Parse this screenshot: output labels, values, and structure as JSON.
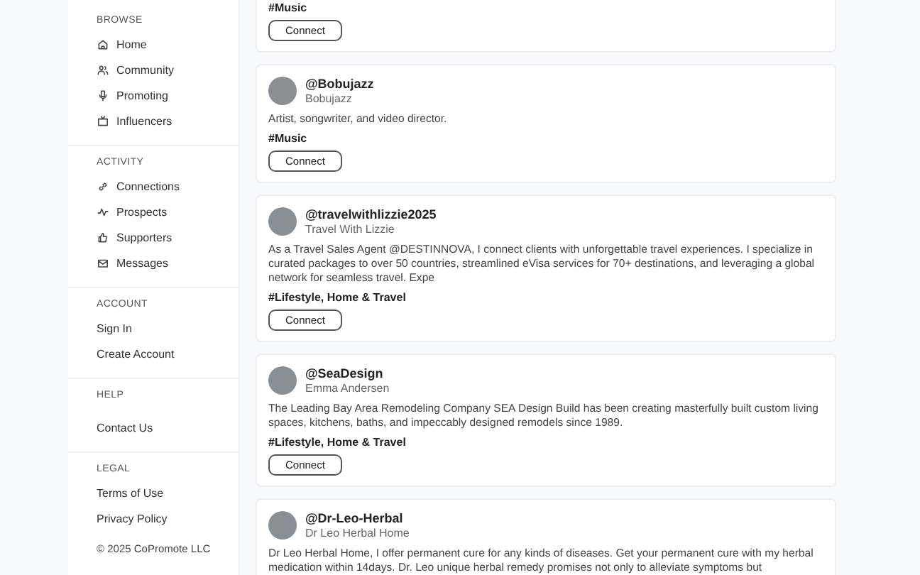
{
  "sidebar": {
    "sections": [
      {
        "heading": "BROWSE",
        "items": [
          "Home",
          "Community",
          "Promoting",
          "Influencers"
        ]
      },
      {
        "heading": "ACTIVITY",
        "items": [
          "Connections",
          "Prospects",
          "Supporters",
          "Messages"
        ]
      },
      {
        "heading": "ACCOUNT",
        "items": [
          "Sign In",
          "Create Account"
        ]
      },
      {
        "heading": "HELP",
        "items": [
          "Contact Us"
        ]
      },
      {
        "heading": "LEGAL",
        "items": [
          "Terms of Use",
          "Privacy Policy"
        ]
      }
    ],
    "copyright": "© 2025 CoPromote LLC"
  },
  "cards": [
    {
      "tag": "#Music",
      "button": "Connect"
    },
    {
      "handle": "@Bobujazz",
      "name": "Bobujazz",
      "bio": "Artist, songwriter, and video director.",
      "tag": "#Music",
      "button": "Connect"
    },
    {
      "handle": "@travelwithlizzie2025",
      "name": "Travel With Lizzie",
      "bio": "As a Travel Sales Agent @DESTINNOVA, I connect clients with unforgettable travel experiences. I specialize in curated packages to over 50 countries, streamlined eVisa services for 70+ destinations, and leveraging a global network for seamless travel. Expe",
      "tag": "#Lifestyle, Home & Travel",
      "button": "Connect"
    },
    {
      "handle": "@SeaDesign",
      "name": "Emma Andersen",
      "bio": "The Leading Bay Area Remodeling Company SEA Design Build has been creating masterfully built custom living spaces, kitchens, baths, and impeccably designed remodels since 1989.",
      "tag": "#Lifestyle, Home & Travel",
      "button": "Connect"
    },
    {
      "handle": "@Dr-Leo-Herbal",
      "name": "Dr Leo Herbal Home",
      "bio": "Dr Leo Herbal Home, I offer permanent cure for any kinds of diseases. Get your permanent cure with my herbal medication within 14days. Dr. Leo unique herbal remedy promises not only to alleviate symptoms but"
    }
  ]
}
